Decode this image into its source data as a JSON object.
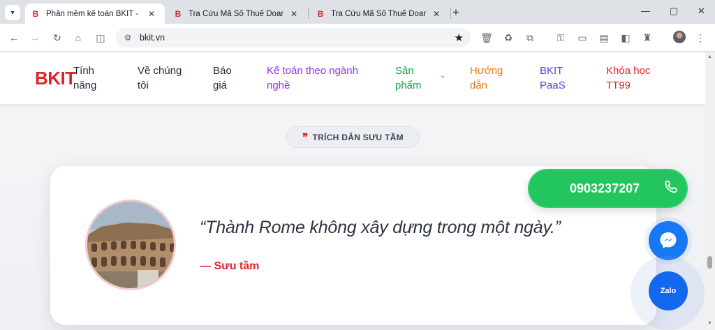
{
  "browser": {
    "tabs": [
      {
        "title": "Phần mềm kế toán BKIT - Tiệm",
        "favicon": "B",
        "active": true
      },
      {
        "title": "Tra Cứu Mã Số Thuế Doanh Ngh",
        "favicon": "B",
        "active": false
      },
      {
        "title": "Tra Cứu Mã Số Thuế Doanh Ngh",
        "favicon": "B",
        "active": false
      }
    ],
    "url": "bkit.vn"
  },
  "site": {
    "logo": "BKIT",
    "nav": [
      {
        "label": "Tính năng",
        "color": "#1f2937"
      },
      {
        "label": "Về chúng tôi",
        "color": "#1f2937"
      },
      {
        "label": "Báo giá",
        "color": "#1f2937"
      },
      {
        "label": "Kế toán theo ngành nghề",
        "color": "#9333ea"
      },
      {
        "label": "Sản phẩm",
        "color": "#16a34a"
      },
      {
        "label": "Hướng dẫn",
        "color": "#ea7a1a"
      },
      {
        "label": "BKIT PaaS",
        "color": "#4f46e5"
      },
      {
        "label": "Khóa học TT99",
        "color": "#e0242b"
      }
    ]
  },
  "section": {
    "pill_label": "TRÍCH DẪN SƯU TẦM",
    "quote": "“Thành Rome không xây dựng trong một ngày.”",
    "author": "— Sưu tầm"
  },
  "floating": {
    "phone": "0903237207",
    "zalo": "Zalo"
  },
  "colors": {
    "brand_red": "#e0242b",
    "phone_green": "#22c55e",
    "messenger_blue": "#1877f2",
    "zalo_blue": "#1468f0"
  }
}
